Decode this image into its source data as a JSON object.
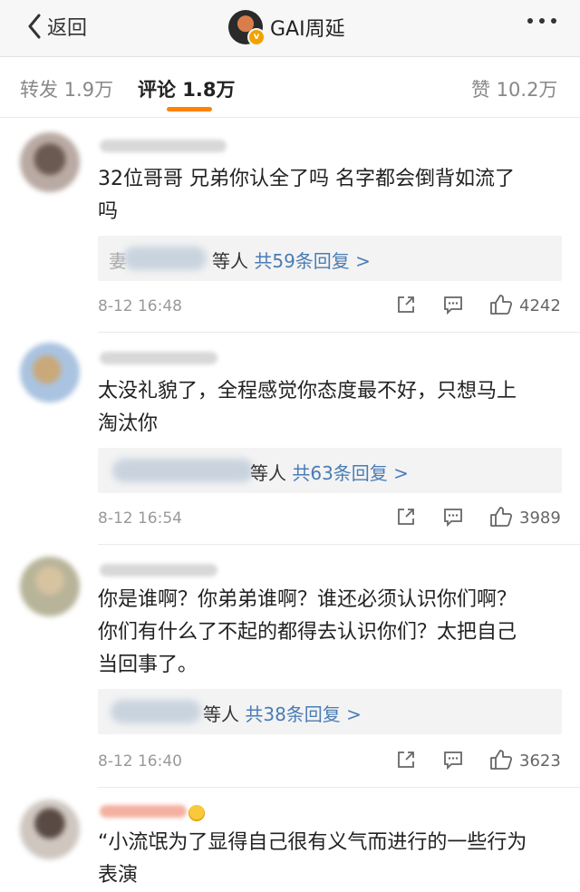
{
  "nav": {
    "back_label": "返回",
    "title": "GAI周延",
    "verified_badge": "v"
  },
  "tabs": [
    {
      "label": "转发 1.9万"
    },
    {
      "label": "评论 1.8万",
      "active": true
    },
    {
      "label": "赞 10.2万"
    }
  ],
  "comments": [
    {
      "text_line1": "32位哥哥 兄弟你认全了吗 名字都会倒背如流了",
      "text_line2": "吗",
      "reply_lead": "妻",
      "reply_suffix": "等人",
      "reply_count": "共59条回复 >",
      "time": "8-12 16:48",
      "likes": "4242"
    },
    {
      "text_line1": "太没礼貌了，全程感觉你态度最不好，只想马上",
      "text_line2": "淘汰你",
      "reply_suffix": "等人",
      "reply_count": "共63条回复 >",
      "time": "8-12 16:54",
      "likes": "3989"
    },
    {
      "text_line1": "你是谁啊？你弟弟谁啊？谁还必须认识你们啊？",
      "text_line2": "你们有什么了不起的都得去认识你们？太把自己",
      "text_line3": "当回事了。",
      "reply_suffix": "等人",
      "reply_count": "共38条回复 >",
      "time": "8-12 16:40",
      "likes": "3623"
    },
    {
      "text_line1": "“小流氓为了显得自己很有义气而进行的一些行为",
      "text_line2": "表演"
    }
  ],
  "colors": {
    "accent": "#ff8200",
    "link": "#4a7cb5",
    "verified": "#f2a200"
  }
}
